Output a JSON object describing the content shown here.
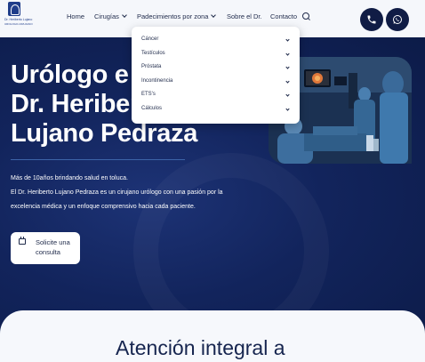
{
  "logo": {
    "name": "Dr. Heriberto Lujano",
    "sub": "UROLOGO-CIRUJANO"
  },
  "nav": {
    "home": "Home",
    "surgeries": "Cirugías",
    "conditions": "Padecimientos por zona",
    "about": "Sobre el Dr.",
    "contact": "Contacto"
  },
  "dropdown": {
    "items": [
      {
        "label": "Cáncer"
      },
      {
        "label": "Testículos"
      },
      {
        "label": "Próstata"
      },
      {
        "label": "Incontinencia"
      },
      {
        "label": "ETS's"
      },
      {
        "label": "Cálculos"
      }
    ]
  },
  "hero": {
    "title_line1": "Urólogo e",
    "title_line2": "Dr. Heriber",
    "title_line3": "Lujano Pedraza",
    "tagline": "Más de 10años brindando salud en toluca.",
    "description_line1": "El Dr. Heriberto Lujano Pedraza es un cirujano urólogo con una pasión por la",
    "description_line2": "excelencia médica y un enfoque comprensivo hacia cada paciente.",
    "cta_label": "Solicite una consulta"
  },
  "section": {
    "title": "Atención integral a"
  },
  "colors": {
    "navy": "#0d1f4f",
    "button_dark": "#101c45",
    "light_bg": "#f6f8fc",
    "accent_rule": "#3d64a8"
  }
}
